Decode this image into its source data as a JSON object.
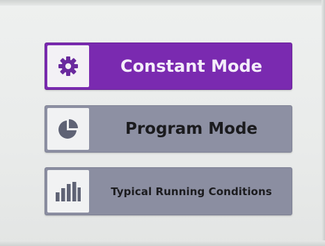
{
  "menu": {
    "items": [
      {
        "id": "constant",
        "label": "Constant Mode",
        "icon": "gear-icon",
        "selected": true
      },
      {
        "id": "program",
        "label": "Program Mode",
        "icon": "pie-chart-icon",
        "selected": false
      },
      {
        "id": "typical",
        "label": "Typical Running Conditions",
        "icon": "bar-chart-icon",
        "selected": false
      }
    ]
  },
  "colors": {
    "selected_bg": "#7a2ab0",
    "unselected_bg": "#8d90a3",
    "icon_color_selected": "#6a2a9e",
    "icon_color_unselected": "#5f6375",
    "screen_bg": "#ecefee"
  }
}
